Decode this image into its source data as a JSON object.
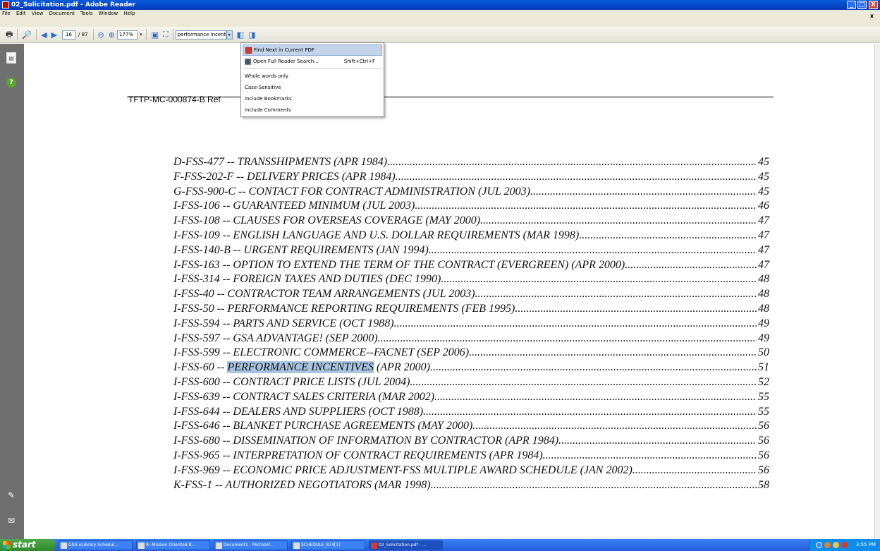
{
  "window": {
    "title": "02_Solicitation.pdf - Adobe Reader",
    "min": "_",
    "max": "□",
    "close": "X"
  },
  "menu": [
    "File",
    "Edit",
    "View",
    "Document",
    "Tools",
    "Window",
    "Help"
  ],
  "menu_close": "x",
  "toolbar": {
    "page_current": "16",
    "page_total": "/ 87",
    "zoom": "177%",
    "search_text": "performance incenti"
  },
  "dropdown": {
    "items": [
      {
        "label": "Find Next in Current PDF",
        "icon": "pdf-icon"
      },
      {
        "label": "Open Full Reader Search...",
        "shortcut": "Shift+Ctrl+F",
        "icon": "binoculars-icon"
      },
      {
        "label": "Whole words only"
      },
      {
        "label": "Case-Sensitive"
      },
      {
        "label": "Include Bookmarks"
      },
      {
        "label": "Include Comments"
      }
    ]
  },
  "document": {
    "header": "TFTP-MC-000874-B  Ref",
    "highlight_text": "PERFORMANCE INCENTIVES",
    "toc": [
      {
        "pre": "D-FSS-477 -- TRANSSHIPMENTS (APR 1984)",
        "page": "45"
      },
      {
        "pre": "F-FSS-202-F -- DELIVERY PRICES (APR 1984)",
        "page": "45"
      },
      {
        "pre": "G-FSS-900-C -- CONTACT FOR CONTRACT ADMINISTRATION (JUL 2003)",
        "page": "45"
      },
      {
        "pre": "I-FSS-106 -- GUARANTEED MINIMUM (JUL 2003)",
        "page": "46"
      },
      {
        "pre": "I-FSS-108 -- CLAUSES FOR OVERSEAS COVERAGE (MAY 2000)",
        "page": "47"
      },
      {
        "pre": "I-FSS-109 -- ENGLISH LANGUAGE AND U.S. DOLLAR REQUIREMENTS (MAR 1998)",
        "page": "47"
      },
      {
        "pre": "I-FSS-140-B -- URGENT REQUIREMENTS (JAN 1994)",
        "page": "47"
      },
      {
        "pre": "I-FSS-163 -- OPTION TO EXTEND THE TERM OF THE CONTRACT (EVERGREEN) (APR 2000)",
        "page": "47"
      },
      {
        "pre": "I-FSS-314 -- FOREIGN TAXES AND DUTIES (DEC 1990)",
        "page": "48"
      },
      {
        "pre": "I-FSS-40 -- CONTRACTOR TEAM ARRANGEMENTS (JUL 2003)",
        "page": "48"
      },
      {
        "pre": "I-FSS-50 -- PERFORMANCE REPORTING REQUIREMENTS (FEB 1995)",
        "page": "48"
      },
      {
        "pre": "I-FSS-594 -- PARTS AND SERVICE (OCT 1988)",
        "page": "49"
      },
      {
        "pre": "I-FSS-597 -- GSA ADVANTAGE! (SEP 2000)",
        "page": "49"
      },
      {
        "pre": "I-FSS-599 -- ELECTRONIC COMMERCE--FACNET (SEP 2006)",
        "page": "50"
      },
      {
        "pre": "I-FSS-60 -- ",
        "hl": "PERFORMANCE INCENTIVES",
        "post": " (APR 2000)",
        "page": "51"
      },
      {
        "pre": "I-FSS-600 -- CONTRACT PRICE LISTS (JUL 2004)",
        "page": "52"
      },
      {
        "pre": "I-FSS-639 -- CONTRACT SALES CRITERIA (MAR 2002)",
        "page": "55"
      },
      {
        "pre": "I-FSS-644 -- DEALERS AND SUPPLIERS (OCT 1988)",
        "page": "55"
      },
      {
        "pre": "I-FSS-646 -- BLANKET PURCHASE AGREEMENTS (MAY 2000)",
        "page": "56"
      },
      {
        "pre": "I-FSS-680 -- DISSEMINATION OF INFORMATION BY CONTRACTOR (APR 1984)",
        "page": "56"
      },
      {
        "pre": "I-FSS-965 -- INTERPRETATION OF CONTRACT REQUIREMENTS (APR 1984)",
        "page": "56"
      },
      {
        "pre": "I-FSS-969 -- ECONOMIC PRICE ADJUSTMENT-FSS MULTIPLE AWARD SCHEDULE (JAN 2002)",
        "page": "56"
      },
      {
        "pre": "K-FSS-1 -- AUTHORIZED NEGOTIATORS (MAR 1998)",
        "page": "58"
      }
    ]
  },
  "taskbar": {
    "start": "start",
    "items": [
      "GSA eLibrary Schedul...",
      "R--Mission Oriented B...",
      "Document1 - Microsof...",
      "SCHEDULE_874[1]",
      "02_Solicitation.pdf - ..."
    ],
    "clock": "3:55 PM"
  }
}
